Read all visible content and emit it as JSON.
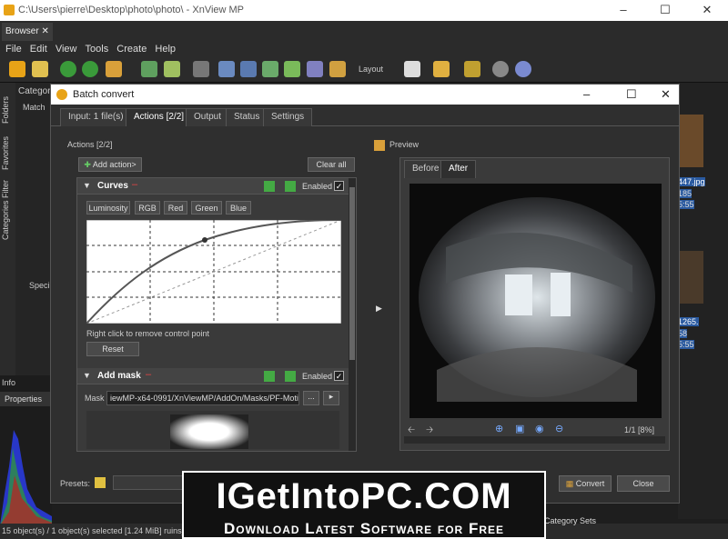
{
  "window": {
    "title": "C:\\Users\\pierre\\Desktop\\photo\\photo\\ - XnView MP"
  },
  "tabs": {
    "browser": "Browser"
  },
  "menu": [
    "File",
    "Edit",
    "View",
    "Tools",
    "Create",
    "Help"
  ],
  "toolbar": {
    "layout_label": "Layout"
  },
  "sidebar": {
    "folders": "Folders",
    "favorites": "Favorites",
    "categories_filter": "Categories Filter",
    "categories_label": "Categorie",
    "match_label": "Match",
    "special_label": "Speci",
    "info_label": "Info",
    "properties_label": "Properties"
  },
  "dialog": {
    "title": "Batch convert",
    "tabs": [
      "Input: 1 file(s)",
      "Actions [2/2]",
      "Output",
      "Status",
      "Settings"
    ],
    "actions_header": "Actions [2/2]",
    "add_action": "Add action>",
    "clear_all": "Clear all",
    "curves": {
      "title": "Curves",
      "enabled": "Enabled",
      "channels": [
        "Luminosity",
        "RGB",
        "Red",
        "Green",
        "Blue"
      ],
      "hint": "Right click to remove control point",
      "reset": "Reset"
    },
    "add_mask": {
      "title": "Add mask",
      "enabled": "Enabled",
      "mask_label": "Mask",
      "mask_path": "iewMP-x64-0991/XnViewMP/AddOn/Masks/PF-Motion.jpg",
      "browse": "...",
      "arrow": "▸"
    },
    "preview": {
      "label": "Preview",
      "tab_before": "Before",
      "tab_after": "After",
      "page_info": "1/1 [8%]"
    },
    "presets_label": "Presets:",
    "convert": "Convert",
    "close": "Close"
  },
  "right_strip": {
    "file1": "447.jpg",
    "v1": "185",
    "v2": "5:55",
    "file2": "1265.",
    "v3": "58",
    "v4": "5:55"
  },
  "status": {
    "text": "15 object(s) / 1 object(s) selected [1.24 MiB]  ruins_m",
    "category_sets": "Category Sets"
  },
  "banner": {
    "title": "IGetIntoPC.COM",
    "subtitle": "Download Latest Software for Free"
  }
}
